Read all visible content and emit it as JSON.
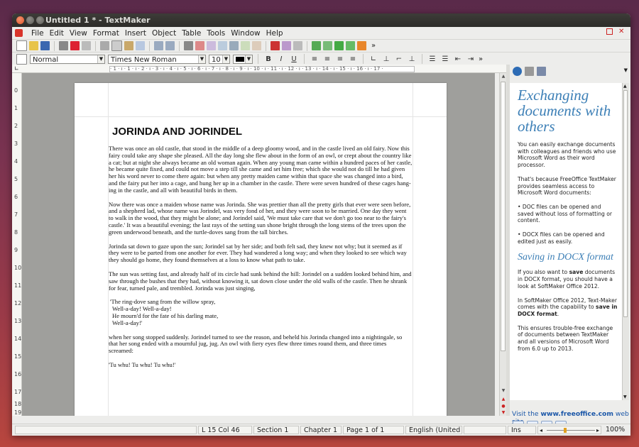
{
  "window": {
    "title": "Untitled 1 * - TextMaker"
  },
  "menu": [
    "File",
    "Edit",
    "View",
    "Format",
    "Insert",
    "Object",
    "Table",
    "Tools",
    "Window",
    "Help"
  ],
  "format_bar": {
    "style": "Normal",
    "font": "Times New Roman",
    "size": "10",
    "color": "#000000",
    "overflow": "»"
  },
  "ruler": {
    "ticks": "· 1 · ı · 1 · ı · 2 · ı · 3 · ı · 4 · ı · 5 · ı · 6 · ı · 7 · ı · 8 · ı · 9 · ı · 10 · ı · 11 · ı · 12 · ı · 13 · ı · 14 · ı · 15 · ı · 16 · ı · 17 ·",
    "vertical": [
      "0",
      "1",
      "2",
      "3",
      "4",
      "5",
      "6",
      "7",
      "8",
      "9",
      "10",
      "11",
      "12",
      "13",
      "14",
      "15",
      "16",
      "17",
      "18",
      "19"
    ]
  },
  "document": {
    "title": "JORINDA AND JORINDEL",
    "paragraphs": [
      "There was once an old castle, that stood in the middle of a deep gloomy wood, and in the castle lived an old fairy. Now this fairy could take any shape she pleased. All the day long she flew about in the form of an owl, or crept about the country like a cat; but at night she always became an old woman again. When any young man came within a hundred paces of her castle, he became quite fixed, and could not move a step till she came and set him free; which she would not do till he had given her his word never to come there again: but when any pretty maiden came within that space she was changed into a bird, and the fairy put her into a cage, and hung her up in a chamber in the castle. There were seven hundred of these cages hang-ing in the castle, and all with beautiful birds in them.",
      "Now there was once a maiden whose name was Jorinda. She was prettier than all the pretty girls that ever were seen before, and a shepherd lad, whose name was Jorindel, was very fond of her, and they were soon to be married. One day they went to walk in the wood, that they might be alone; and Jorindel said, 'We must take care that we don't go too near to the fairy's castle.' It was a beautiful evening; the last rays of the setting sun shone bright through the long stems of the trees upon the green underwood beneath, and the turtle-doves sang from the tall birches.",
      "Jorinda sat down to gaze upon the sun; Jorindel sat by her side; and both felt sad, they knew not why; but it seemed as if they were to be parted from one another for ever. They had wandered a long way; and when they looked to see which way they should go home, they found themselves at a loss to know what path to take.",
      "The sun was setting fast, and already half of its circle had sunk behind the hill: Jorindel on a sudden looked behind him, and saw through the bushes that they had, without knowing it, sat down close under the old walls of the castle. Then he shrank for fear, turned pale, and trembled. Jorinda was just singing,"
    ],
    "verse": [
      "'The ring-dove sang from the willow spray,",
      "  Well-a-day! Well-a-day!",
      "  He mourn'd for the fate of his darling mate,",
      "  Well-a-day!'"
    ],
    "after_verse": "when her song stopped suddenly. Jorindel turned to see the reason, and beheld his Jorinda changed into a nightingale, so that her song ended with a mournful jug, jug. An owl with fiery eyes flew three times round them, and three times screamed:",
    "last": "'Tu whu! Tu whu! Tu whu!'"
  },
  "side_panel": {
    "heading": "Exchanging documents with others",
    "p1": "You can easily exchange documents with colleagues and friends who use Microsoft Word as their word processor.",
    "p2": "That's because FreeOffice TextMaker provides seamless access to Microsoft Word documents:",
    "bullet1": "• DOC files can be opened and saved without loss of formatting or content.",
    "bullet2": "• DOCX files can be opened and edited just as easily.",
    "heading2": "Saving in DOCX format",
    "p3_pre": "If you also want to ",
    "p3_bold": "save",
    "p3_post": " documents in DOCX format, you should have a look at SoftMaker Office 2012.",
    "p4_pre": "In SoftMaker Office 2012, Text-Maker comes with the capability to ",
    "p4_bold": "save in DOCX format",
    "p4_post": ".",
    "p5": "This ensures trouble-free exchange of documents between TextMaker and all versions of Microsoft Word from 6.0 up to 2013.",
    "link_pre": "Visit the ",
    "link_url": "www.freeoffice.com",
    "link_post": " web site"
  },
  "status": {
    "position": "L 15 Col 46",
    "section": "Section 1",
    "chapter": "Chapter 1",
    "page": "Page 1 of 1",
    "language": "English (United",
    "mode": "Ins",
    "zoom": "100%"
  }
}
